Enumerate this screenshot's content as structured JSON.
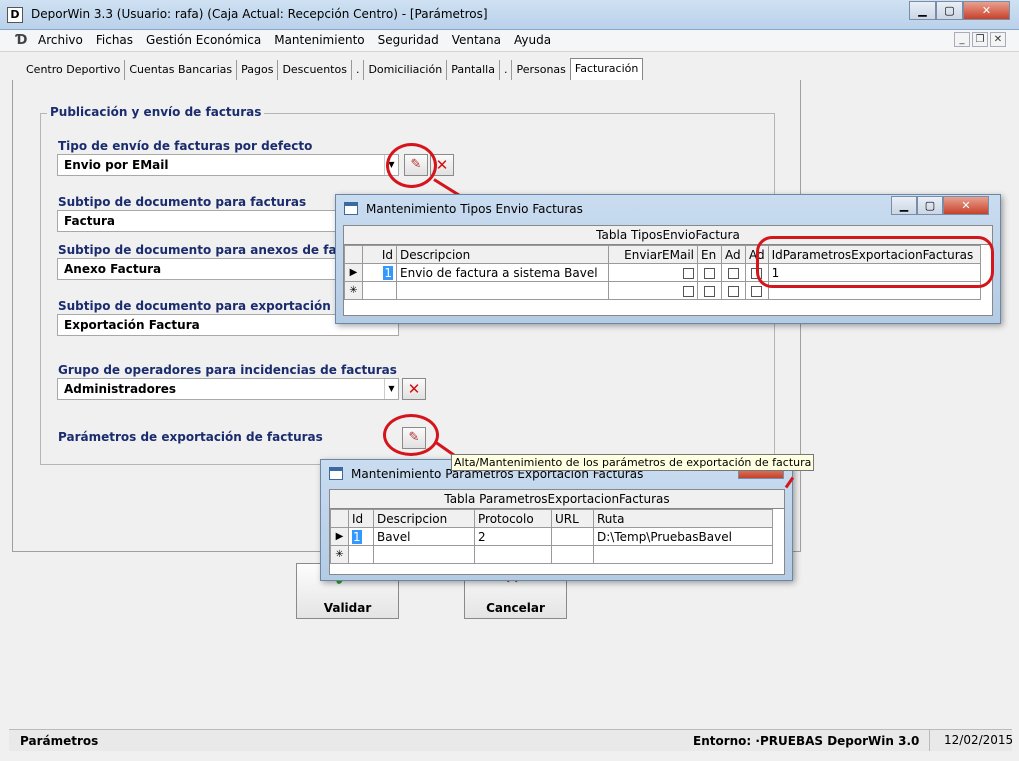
{
  "window": {
    "title": "DeporWin 3.3  (Usuario: rafa)  (Caja Actual: Recepción Centro) - [Parámetros]"
  },
  "menu": [
    "Archivo",
    "Fichas",
    "Gestión Económica",
    "Mantenimiento",
    "Seguridad",
    "Ventana",
    "Ayuda"
  ],
  "tabs": [
    "Centro Deportivo",
    "Cuentas Bancarias",
    "Pagos",
    "Descuentos",
    ".",
    "Domiciliación",
    "Pantalla",
    ".",
    "Personas",
    "Facturación"
  ],
  "group": {
    "label": "Publicación y envío de facturas",
    "fields": [
      {
        "label": "Tipo de envío de facturas por defecto",
        "value": "Envio por EMail"
      },
      {
        "label": "Subtipo de documento para facturas",
        "value": "Factura"
      },
      {
        "label": "Subtipo de documento para anexos de facturas",
        "value": "Anexo Factura"
      },
      {
        "label": "Subtipo de documento para exportación de factu",
        "value": "Exportación Factura"
      },
      {
        "label": "Grupo de operadores para incidencias de facturas",
        "value": "Administradores"
      }
    ],
    "export_label": "Parámetros de exportación de facturas"
  },
  "buttons": {
    "validar": "Validar",
    "cancelar": "Cancelar"
  },
  "tooltip": "Alta/Mantenimiento de los parámetros de exportación de factura",
  "dialog1": {
    "title": "Mantenimiento Tipos Envio Facturas",
    "table_caption": "Tabla TiposEnvioFactura",
    "columns": [
      "Id",
      "Descripcion",
      "EnviarEMail",
      "En",
      "Ad",
      "Ad",
      "IdParametrosExportacionFacturas"
    ],
    "rows": [
      {
        "id": "1",
        "descripcion": "Envio de factura a sistema Bavel",
        "idparam": "1"
      }
    ]
  },
  "dialog2": {
    "title": "Mantenimiento Parametros Exportacion Facturas",
    "table_caption": "Tabla ParametrosExportacionFacturas",
    "columns": [
      "Id",
      "Descripcion",
      "Protocolo",
      "URL",
      "Ruta"
    ],
    "rows": [
      {
        "id": "1",
        "descripcion": "Bavel",
        "protocolo": "2",
        "url": "",
        "ruta": "D:\\Temp\\PruebasBavel"
      }
    ]
  },
  "statusbar": {
    "left": "Parámetros",
    "entorno": "Entorno: ·PRUEBAS DeporWin 3.0",
    "date": "12/02/2015"
  },
  "colors": {
    "annotation_red": "#d4151c",
    "label_blue": "#1a2c6e",
    "selection": "#3399ff"
  }
}
